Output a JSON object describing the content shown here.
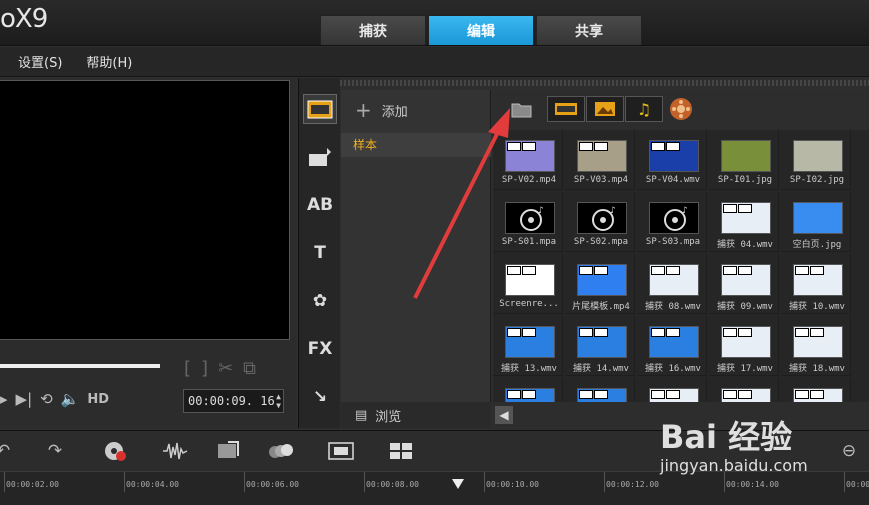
{
  "app": {
    "title": "oX9"
  },
  "tabs": [
    {
      "label": "捕获",
      "active": false
    },
    {
      "label": "编辑",
      "active": true
    },
    {
      "label": "共享",
      "active": false
    }
  ],
  "menu": {
    "settings": "设置(S)",
    "help": "帮助(H)"
  },
  "player": {
    "timecode": "00:00:09. 16",
    "hd_label": "HD"
  },
  "library": {
    "add_label": "添加",
    "folder_item": "样本",
    "browse_label": "浏览"
  },
  "media_items": [
    {
      "name": "SP-V02.mp4",
      "kind": "video",
      "color": "#8a83d6"
    },
    {
      "name": "SP-V03.mp4",
      "kind": "video",
      "color": "#a89f88"
    },
    {
      "name": "SP-V04.wmv",
      "kind": "video",
      "color": "#1b3fa8"
    },
    {
      "name": "SP-I01.jpg",
      "kind": "image",
      "color": "#7a8f3a"
    },
    {
      "name": "SP-I02.jpg",
      "kind": "image",
      "color": "#b8b8a6"
    },
    {
      "name": "SP-S01.mpa",
      "kind": "audio",
      "color": "#000000"
    },
    {
      "name": "SP-S02.mpa",
      "kind": "audio",
      "color": "#000000"
    },
    {
      "name": "SP-S03.mpa",
      "kind": "audio",
      "color": "#000000"
    },
    {
      "name": "捕获 04.wmv",
      "kind": "video",
      "color": "#e8eef6"
    },
    {
      "name": "空白页.jpg",
      "kind": "image",
      "color": "#3a8df0"
    },
    {
      "name": "Screenre...",
      "kind": "video",
      "color": "#ffffff"
    },
    {
      "name": "片尾模板.mp4",
      "kind": "video",
      "color": "#2f7ff0"
    },
    {
      "name": "捕获 08.wmv",
      "kind": "video",
      "color": "#e8eef6"
    },
    {
      "name": "捕获 09.wmv",
      "kind": "video",
      "color": "#e8eef6"
    },
    {
      "name": "捕获 10.wmv",
      "kind": "video",
      "color": "#e8eef6"
    },
    {
      "name": "捕获 13.wmv",
      "kind": "video",
      "color": "#2a7fe0"
    },
    {
      "name": "捕获 14.wmv",
      "kind": "video",
      "color": "#2a7fe0"
    },
    {
      "name": "捕获 16.wmv",
      "kind": "video",
      "color": "#2a7fe0"
    },
    {
      "name": "捕获 17.wmv",
      "kind": "video",
      "color": "#e8eef6"
    },
    {
      "name": "捕获 18.wmv",
      "kind": "video",
      "color": "#e8eef6"
    },
    {
      "name": "",
      "kind": "video",
      "color": "#2a7fe0"
    },
    {
      "name": "",
      "kind": "video",
      "color": "#2a7fe0"
    },
    {
      "name": "",
      "kind": "video",
      "color": "#e8eef6"
    },
    {
      "name": "",
      "kind": "video",
      "color": "#e8eef6"
    },
    {
      "name": "",
      "kind": "video",
      "color": "#e8eef6"
    }
  ],
  "timeline": {
    "ticks": [
      "00:00:02.00",
      "00:00:04.00",
      "00:00:06.00",
      "00:00:08.00",
      "00:00:10.00",
      "00:00:12.00",
      "00:00:14.00",
      "00:00:16.00"
    ]
  },
  "watermark": {
    "brand": "Bai 经验",
    "url": "jingyan.baidu.com"
  },
  "colors": {
    "accent": "#1a97d6",
    "folder_text": "#f0b020",
    "annotation_arrow": "#e23b3b"
  }
}
